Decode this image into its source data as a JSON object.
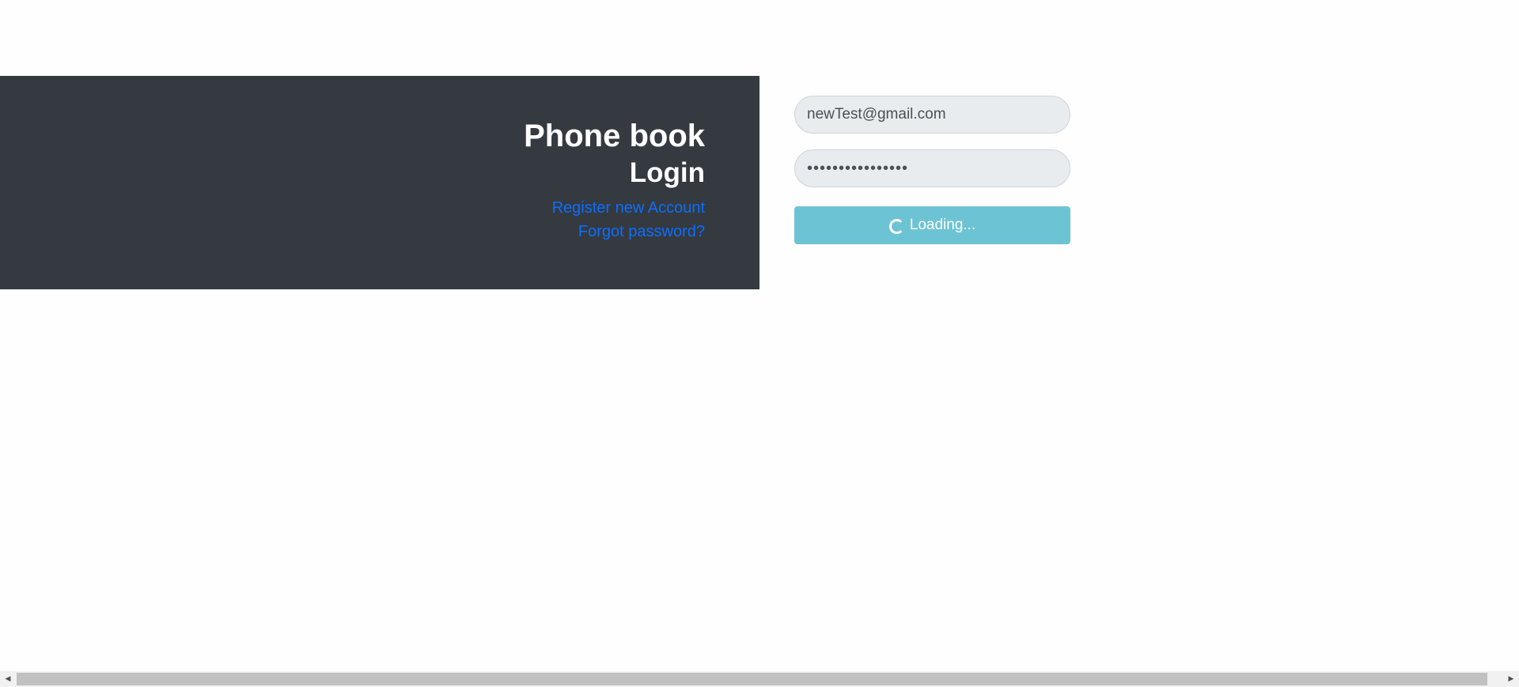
{
  "header": {
    "app_title": "Phone book",
    "page_title": "Login",
    "register_link": "Register new Account",
    "forgot_link": "Forgot password?"
  },
  "form": {
    "email_value": "newTest@gmail.com",
    "password_value": "••••••••••••••••",
    "submit_label": "Loading..."
  },
  "colors": {
    "panel_bg": "#343a40",
    "link": "#0d6efd",
    "button_bg": "#6cc3d3",
    "input_bg": "#e9ecef"
  },
  "icons": {
    "spinner": "loading-spinner-icon",
    "scroll_left": "arrow-left-icon",
    "scroll_right": "arrow-right-icon"
  }
}
